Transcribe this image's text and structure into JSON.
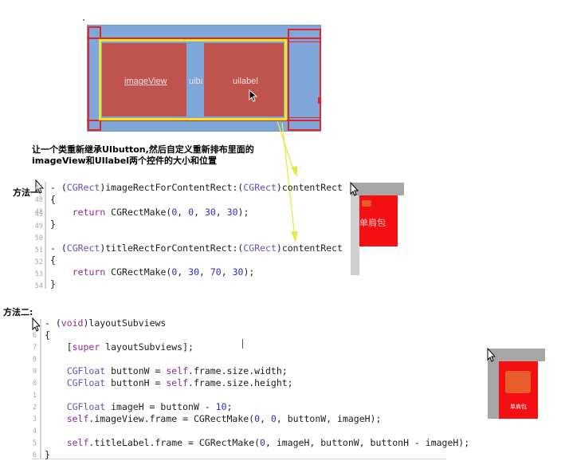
{
  "diagram": {
    "image_view_label": "imageView",
    "mid_label": "uiba",
    "uilabel_label": "uilabel"
  },
  "caption": {
    "line1": "让一个类重新继承UIbutton,然后自定义重新排布里面的",
    "line2": "imageView和UIlabel两个控件的大小和位置"
  },
  "method1": {
    "label": "方法一",
    "lines": [
      {
        "num": "47",
        "text": "- (CGRect)imageRectForContentRect:(CGRect)contentRect"
      },
      {
        "num": "48",
        "text": "{"
      },
      {
        "num": "49",
        "text": "    return CGRectMake(0, 0, 30, 30);"
      },
      {
        "num": "49",
        "text": "}"
      },
      {
        "num": "50",
        "text": ""
      },
      {
        "num": "51",
        "text": "- (CGRect)titleRectForContentRect:(CGRect)contentRect"
      },
      {
        "num": "52",
        "text": "{"
      },
      {
        "num": "53",
        "text": "    return CGRectMake(0, 30, 70, 30);"
      },
      {
        "num": "54",
        "text": "}"
      }
    ]
  },
  "method2": {
    "label": "方法二:",
    "lines": [
      {
        "num": "",
        "text": "- (void)layoutSubviews"
      },
      {
        "num": "6",
        "text": "{"
      },
      {
        "num": "7",
        "text": "    [super layoutSubviews];"
      },
      {
        "num": "8",
        "text": ""
      },
      {
        "num": "9",
        "text": "    CGFloat buttonW = self.frame.size.width;"
      },
      {
        "num": "0",
        "text": "    CGFloat buttonH = self.frame.size.height;"
      },
      {
        "num": "1",
        "text": ""
      },
      {
        "num": "2",
        "text": "    CGFloat imageH = buttonW - 10;"
      },
      {
        "num": "3",
        "text": "    self.imageView.frame = CGRectMake(0, 0, buttonW, imageH);"
      },
      {
        "num": "4",
        "text": ""
      },
      {
        "num": "5",
        "text": "    self.titleLabel.frame = CGRectMake(0, imageH, buttonW, buttonH - imageH);"
      },
      {
        "num": "6",
        "text": "}"
      }
    ]
  },
  "preview1": {
    "label": "单肩包"
  },
  "preview2": {
    "label": "单肩包"
  },
  "colors": {
    "red": "#f40f12",
    "yellow": "#f0e81e",
    "blue": "#7ea6d8",
    "brick": "#c0534e"
  }
}
